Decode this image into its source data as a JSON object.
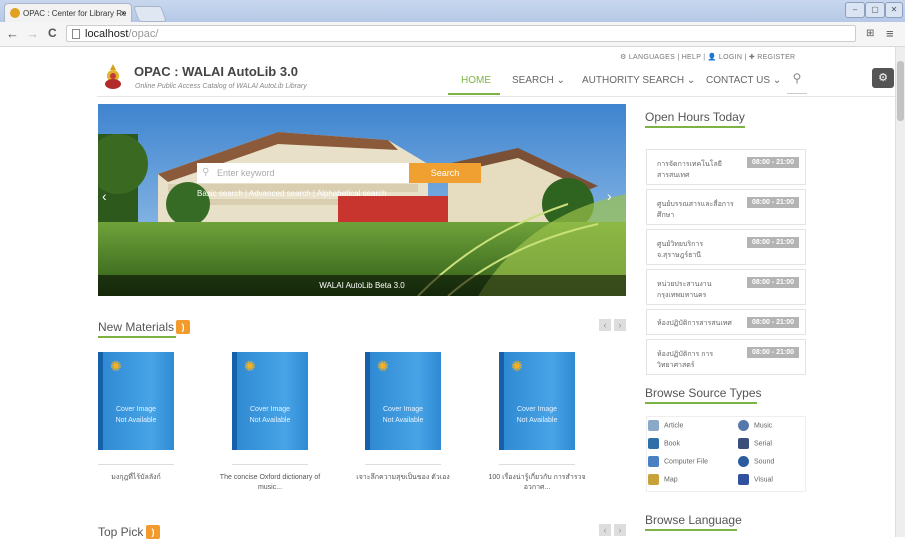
{
  "browser": {
    "tab_title": "OPAC : Center for Library Re",
    "tab_close": "×",
    "url_host": "localhost",
    "url_path": "/opac/",
    "win_min": "–",
    "win_max": "▢",
    "win_close": "✕",
    "back": "←",
    "forward": "→",
    "reload": "C",
    "menu": "≡",
    "ext": "⊞"
  },
  "header": {
    "top_links": "⚙ LANGUAGES  |  HELP  |  👤 LOGIN  |  ✚ REGISTER",
    "brand": "OPAC : WALAI AutoLib 3.0",
    "tagline": "Online Public Access Catalog of WALAI AutoLib Library",
    "nav": [
      "HOME",
      "SEARCH ⌄",
      "AUTHORITY SEARCH ⌄",
      "CONTACT US ⌄"
    ],
    "search_icon": "⚲",
    "gear_icon": "⚙"
  },
  "hero": {
    "keyword_placeholder": "Enter keyword",
    "search_button": "Search",
    "search_tabs": "Basic search | Advanced search | Alphabetical search",
    "caption": "WALAI AutoLib Beta 3.0",
    "prev": "‹",
    "next": "›"
  },
  "new_materials": {
    "title": "New Materials",
    "cover_text_1": "Cover Image",
    "cover_text_2": "Not Available",
    "items": [
      {
        "title": "มงกุฎที่ไร้บัลลังก์"
      },
      {
        "title": "The concise Oxford dictionary of music..."
      },
      {
        "title": "เจาะลึกความสุขเป็นของ ตัวเอง"
      },
      {
        "title": "100 เรื่องน่ารู้เกี่ยวกับ การสำรวจอวกาศ..."
      }
    ]
  },
  "top_pick": {
    "title": "Top Pick"
  },
  "open_hours": {
    "title": "Open Hours Today",
    "items": [
      {
        "name": "การจัดการเทคโนโลยี สารสนเทศ",
        "time": "08:00 - 21:00"
      },
      {
        "name": "ศูนย์บรรณสารและสื่อการ ศึกษา",
        "time": "08:00 - 21:00"
      },
      {
        "name": "ศูนย์วิทยบริการ จ.สุราษฎร์ธานี",
        "time": "08:00 - 21:00"
      },
      {
        "name": "หน่วยประสานงาน กรุงเทพมหานคร",
        "time": "08:00 - 21:00"
      },
      {
        "name": "ห้องปฏิบัติการสารสนเทศ",
        "time": "08:00 - 21:00"
      },
      {
        "name": "ห้องปฏิบัติการ การวิทยาศาสตร์",
        "time": "08:00 - 21:00"
      }
    ]
  },
  "source_types": {
    "title": "Browse Source Types",
    "items": [
      {
        "label": "Article",
        "color": "#8aa9c9"
      },
      {
        "label": "Music",
        "color": "#5577aa"
      },
      {
        "label": "Book",
        "color": "#2f6fa8"
      },
      {
        "label": "Serial",
        "color": "#3a4f7a"
      },
      {
        "label": "Computer File",
        "color": "#4a7fc1"
      },
      {
        "label": "Sound",
        "color": "#2b5c9e"
      },
      {
        "label": "Map",
        "color": "#c8a13a"
      },
      {
        "label": "Visual",
        "color": "#3050a0"
      }
    ]
  },
  "browse_language": {
    "title": "Browse Language"
  },
  "colors": {
    "accent": "#7cb342",
    "orange": "#f0a030"
  }
}
